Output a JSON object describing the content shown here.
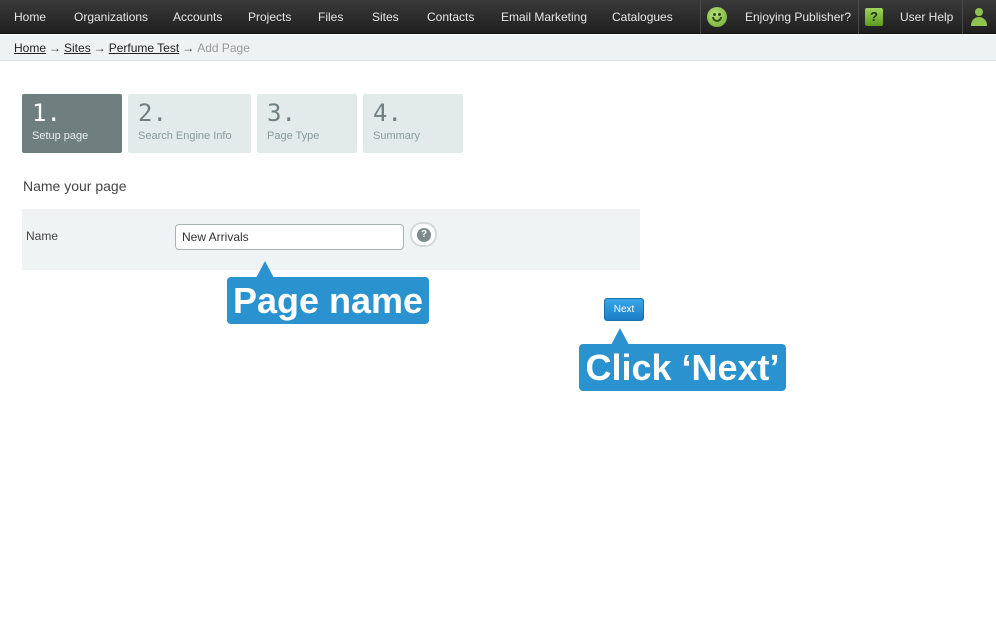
{
  "nav": {
    "items": [
      "Home",
      "Organizations",
      "Accounts",
      "Projects",
      "Files",
      "Sites",
      "Contacts",
      "Email Marketing",
      "Catalogues"
    ],
    "feedback_label": "Enjoying Publisher?",
    "help_label": "User Help",
    "help_icon_glyph": "?"
  },
  "breadcrumb": {
    "links": [
      "Home",
      "Sites",
      "Perfume Test"
    ],
    "separator": "→",
    "current": "Add Page"
  },
  "steps": [
    {
      "num": "1.",
      "label": "Setup page",
      "active": true
    },
    {
      "num": "2.",
      "label": "Search Engine Info",
      "active": false
    },
    {
      "num": "3.",
      "label": "Page Type",
      "active": false
    },
    {
      "num": "4.",
      "label": "Summary",
      "active": false
    }
  ],
  "form": {
    "section_title": "Name your page",
    "name_label": "Name",
    "name_value": "New Arrivals",
    "help_glyph": "?"
  },
  "actions": {
    "next_label": "Next"
  },
  "callouts": {
    "page_name": "Page name",
    "click_next": "Click ‘Next’"
  },
  "colors": {
    "accent": "#2a93cf",
    "nav_bg": "#2a2a2a",
    "step_active": "#6f7e7e"
  }
}
